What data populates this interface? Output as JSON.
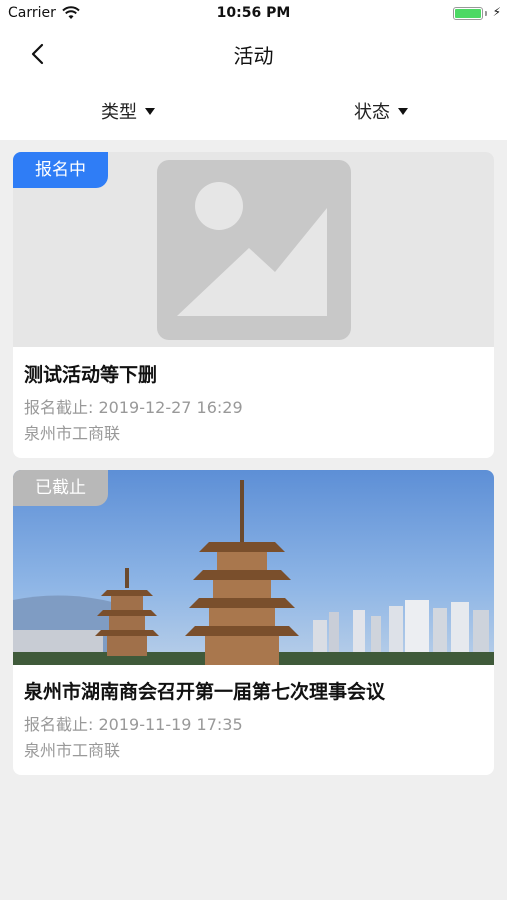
{
  "status_bar": {
    "carrier": "Carrier",
    "time": "10:56 PM",
    "battery_level": 1.0,
    "icons": [
      "wifi-icon",
      "battery-icon",
      "charging-bolt-icon"
    ]
  },
  "nav": {
    "title": "活动",
    "back_icon": "chevron-left-icon"
  },
  "filters": {
    "type_label": "类型",
    "status_label": "状态",
    "caret_icon": "caret-down-icon"
  },
  "activities": [
    {
      "badge": "报名中",
      "badge_color": "#2f7df6",
      "image": "image-placeholder-icon",
      "title": "测试活动等下删",
      "deadline": "报名截止: 2019-12-27 16:29",
      "organizer": "泉州市工商联"
    },
    {
      "badge": "已截止",
      "badge_color": "#b8b8b8",
      "image": "pagoda-skyline-photo",
      "title": "泉州市湖南商会召开第一届第七次理事会议",
      "deadline": "报名截止: 2019-11-19 17:35",
      "organizer": "泉州市工商联"
    }
  ],
  "colors": {
    "accent": "#2f7df6",
    "background": "#efefef",
    "muted_text": "#999999"
  }
}
